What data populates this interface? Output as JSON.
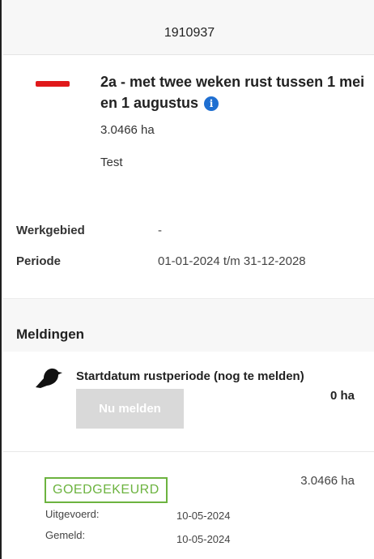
{
  "header": {
    "title": "1910937"
  },
  "zone": {
    "color": "#e0191b",
    "title": "2a - met twee weken rust tussen 1 mei en 1 augustus",
    "info_icon": "info-icon",
    "area": "3.0466 ha",
    "note": "Test"
  },
  "details": {
    "werkgebied_label": "Werkgebied",
    "werkgebied_value": "-",
    "periode_label": "Periode",
    "periode_value": "01-01-2024 t/m 31-12-2028"
  },
  "meldingen": {
    "title": "Meldingen",
    "item": {
      "icon": "bird-icon",
      "title": "Startdatum rustperiode (nog te melden)",
      "area": "0 ha",
      "button_label": "Nu melden"
    }
  },
  "status": {
    "badge": "GOEDGEKEURD",
    "badge_color": "#6cb33f",
    "area": "3.0466 ha",
    "uitgevoerd_label": "Uitgevoerd:",
    "uitgevoerd_value": "10-05-2024",
    "gemeld_label": "Gemeld:",
    "gemeld_value": "10-05-2024"
  }
}
